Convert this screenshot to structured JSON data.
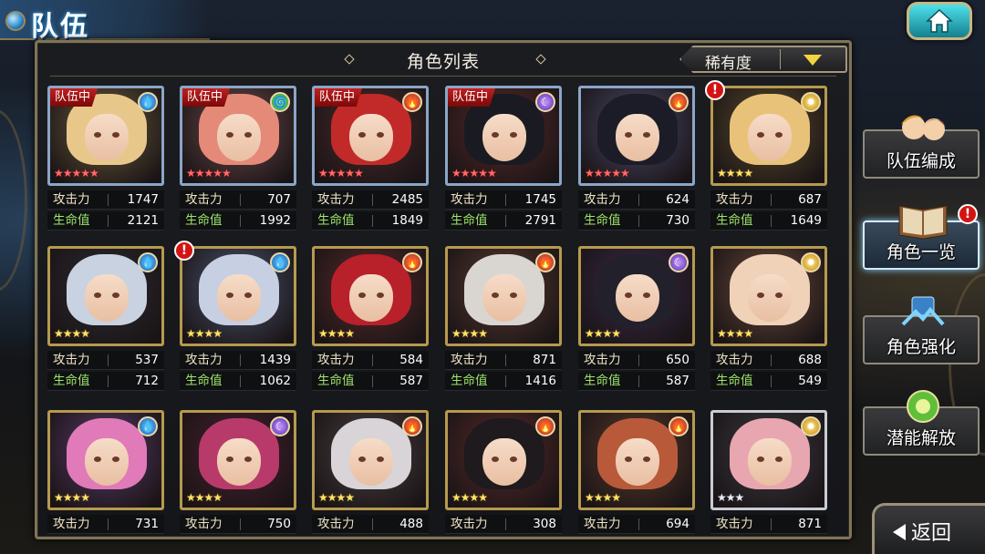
{
  "header": {
    "title": "队伍"
  },
  "panel": {
    "title": "角色列表",
    "sort_label": "稀有度"
  },
  "labels": {
    "attack": "攻击力",
    "hp": "生命值",
    "team_badge": "队伍中",
    "notice": "!"
  },
  "side_menu": [
    {
      "label": "队伍编成",
      "active": false
    },
    {
      "label": "角色一览",
      "active": true,
      "notice": true
    },
    {
      "label": "角色强化",
      "active": false
    },
    {
      "label": "潜能解放",
      "active": false
    }
  ],
  "back_label": "返回",
  "colors": {
    "water": "#1e7fd6",
    "fire": "#d3341a",
    "wind": "#2ca23a",
    "dark": "#7b45c9",
    "light": "#d9a21a",
    "team_badge": "#b51818",
    "hp_label": "#9ee66a"
  },
  "characters": [
    {
      "in_team": true,
      "element": "water",
      "stars": 5,
      "star_color": "red",
      "atk": "1747",
      "hp": "2121",
      "hair": "#e8c78a",
      "bg": "#6a5a3a"
    },
    {
      "in_team": true,
      "element": "wind",
      "stars": 5,
      "star_color": "red",
      "atk": "707",
      "hp": "1992",
      "hair": "#e58a78",
      "bg": "#6a4a4a"
    },
    {
      "in_team": true,
      "element": "fire",
      "stars": 5,
      "star_color": "red",
      "atk": "2485",
      "hp": "1849",
      "hair": "#c22a2a",
      "bg": "#4a2a2a"
    },
    {
      "in_team": true,
      "element": "dark",
      "stars": 5,
      "star_color": "red",
      "atk": "1745",
      "hp": "2791",
      "hair": "#1a1a22",
      "bg": "#5a2a2a"
    },
    {
      "in_team": false,
      "element": "fire",
      "stars": 5,
      "star_color": "red",
      "atk": "624",
      "hp": "730",
      "hair": "#1c1c28",
      "bg": "#4a4a6a"
    },
    {
      "in_team": false,
      "element": "light",
      "stars": 4,
      "star_color": "gold",
      "atk": "687",
      "hp": "1649",
      "hair": "#e9c27a",
      "bg": "#5a4a2a",
      "notice": true
    },
    {
      "in_team": false,
      "element": "water",
      "stars": 4,
      "star_color": "gold",
      "atk": "537",
      "hp": "712",
      "hair": "#c9d2e0",
      "bg": "#2a2a30"
    },
    {
      "in_team": false,
      "element": "water",
      "stars": 4,
      "star_color": "gold",
      "atk": "1439",
      "hp": "1062",
      "hair": "#c7cfe2",
      "bg": "#4a5570",
      "notice": true
    },
    {
      "in_team": false,
      "element": "fire",
      "stars": 4,
      "star_color": "gold",
      "atk": "584",
      "hp": "587",
      "hair": "#b8202a",
      "bg": "#5a2a2a"
    },
    {
      "in_team": false,
      "element": "fire",
      "stars": 4,
      "star_color": "gold",
      "atk": "871",
      "hp": "1416",
      "hair": "#d9d6d2",
      "bg": "#5a3a30"
    },
    {
      "in_team": false,
      "element": "dark",
      "stars": 4,
      "star_color": "gold",
      "atk": "650",
      "hp": "587",
      "hair": "#22202a",
      "bg": "#3a2a4a"
    },
    {
      "in_team": false,
      "element": "light",
      "stars": 4,
      "star_color": "gold",
      "atk": "688",
      "hp": "549",
      "hair": "#f0d2b8",
      "bg": "#6a4a3a"
    },
    {
      "in_team": false,
      "element": "water",
      "stars": 4,
      "star_color": "gold",
      "atk": "731",
      "hp": "",
      "hair": "#e07ab8",
      "bg": "#5a3a6a"
    },
    {
      "in_team": false,
      "element": "dark",
      "stars": 4,
      "star_color": "gold",
      "atk": "750",
      "hp": "",
      "hair": "#b83a6a",
      "bg": "#4a2030"
    },
    {
      "in_team": false,
      "element": "fire",
      "stars": 4,
      "star_color": "gold",
      "atk": "488",
      "hp": "",
      "hair": "#d8d4d8",
      "bg": "#4a4040"
    },
    {
      "in_team": false,
      "element": "fire",
      "stars": 4,
      "star_color": "gold",
      "atk": "308",
      "hp": "",
      "hair": "#1e1a1e",
      "bg": "#5a2a2a"
    },
    {
      "in_team": false,
      "element": "fire",
      "stars": 4,
      "star_color": "gold",
      "atk": "694",
      "hp": "",
      "hair": "#b85a3a",
      "bg": "#5a3a2a"
    },
    {
      "in_team": false,
      "element": "light",
      "stars": 3,
      "star_color": "silver",
      "atk": "871",
      "hp": "",
      "hair": "#e8a6b0",
      "bg": "#3a3a40"
    }
  ]
}
